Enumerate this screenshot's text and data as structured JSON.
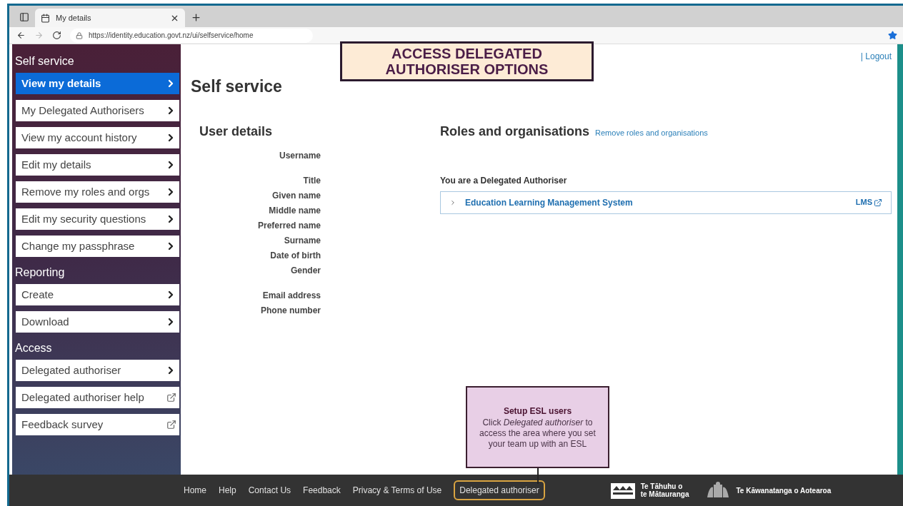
{
  "browser": {
    "tab_title": "My details",
    "url": "https://identity.education.govt.nz/ui/selfservice/home"
  },
  "callout": {
    "title": "ACCESS DELEGATED AUTHORISER OPTIONS"
  },
  "sidebar": {
    "sections": [
      {
        "title": "Self service",
        "items": [
          {
            "label": "View my details",
            "selected": true,
            "kind": "link"
          },
          {
            "label": "My Delegated Authorisers",
            "selected": false,
            "kind": "link"
          },
          {
            "label": "View my account history",
            "selected": false,
            "kind": "link"
          },
          {
            "label": "Edit my details",
            "selected": false,
            "kind": "link"
          },
          {
            "label": "Remove my roles and orgs",
            "selected": false,
            "kind": "link"
          },
          {
            "label": "Edit my security questions",
            "selected": false,
            "kind": "link"
          },
          {
            "label": "Change my passphrase",
            "selected": false,
            "kind": "link"
          }
        ]
      },
      {
        "title": "Reporting",
        "items": [
          {
            "label": "Create",
            "selected": false,
            "kind": "link"
          },
          {
            "label": "Download",
            "selected": false,
            "kind": "link"
          }
        ]
      },
      {
        "title": "Access",
        "items": [
          {
            "label": "Delegated authoriser",
            "selected": false,
            "kind": "link"
          },
          {
            "label": "Delegated authoriser help",
            "selected": false,
            "kind": "external"
          },
          {
            "label": "Feedback survey",
            "selected": false,
            "kind": "external"
          }
        ]
      }
    ]
  },
  "page": {
    "title": "Self service",
    "logout": "| Logout"
  },
  "user_details": {
    "heading": "User details",
    "groups": [
      [
        "Username"
      ],
      [
        "Title",
        "Given name",
        "Middle name",
        "Preferred name",
        "Surname",
        "Date of birth",
        "Gender"
      ],
      [
        "Email address",
        "Phone number"
      ]
    ]
  },
  "roles": {
    "heading": "Roles and organisations",
    "link": "Remove roles and organisations",
    "subheading": "You are a Delegated Authoriser",
    "entries": [
      {
        "name": "Education Learning Management System",
        "tag": "LMS",
        "expanded": false
      }
    ]
  },
  "tooltip": {
    "title": "Setup ESL users",
    "body": "Click *Delegated authoriser* to access the area where you set your team up with an ESL"
  },
  "footer": {
    "links": [
      {
        "label": "Home",
        "highlighted": false
      },
      {
        "label": "Help",
        "highlighted": false
      },
      {
        "label": "Contact Us",
        "highlighted": false
      },
      {
        "label": "Feedback",
        "highlighted": false
      },
      {
        "label": "Privacy & Terms of Use",
        "highlighted": false
      },
      {
        "label": "Delegated authoriser",
        "highlighted": true
      }
    ],
    "logos": [
      {
        "lines": [
          "Te Tāhuhu o",
          "te Mātauranga"
        ]
      },
      {
        "lines": [
          "Te Kāwanatanga o Aotearoa"
        ]
      }
    ]
  }
}
